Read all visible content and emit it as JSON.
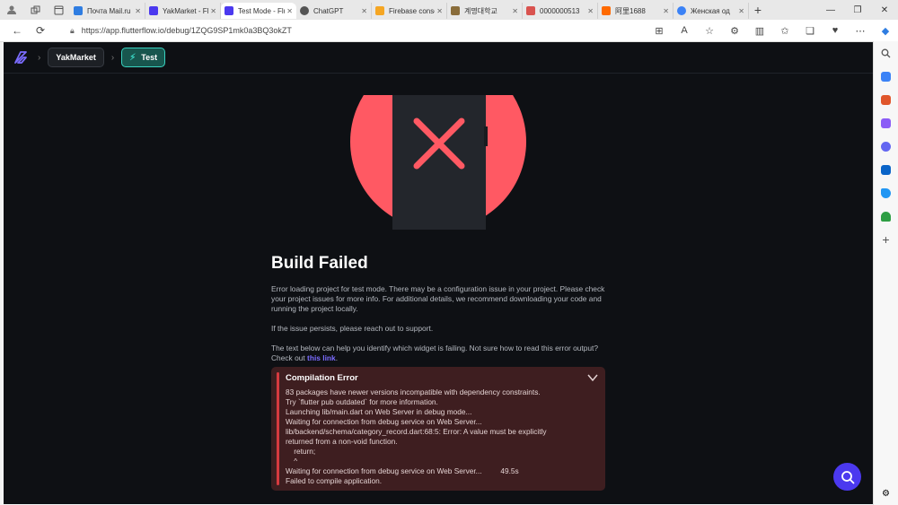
{
  "browser": {
    "tabs": [
      {
        "title": "Почта Mail.ru",
        "favicon_color": "#2f7de1",
        "active": false
      },
      {
        "title": "YakMarket - FlutterFlow",
        "favicon_color": "#4b39ef",
        "active": false
      },
      {
        "title": "Test Mode - FlutterFlow",
        "favicon_color": "#4b39ef",
        "active": true
      },
      {
        "title": "ChatGPT",
        "favicon_color": "#555555",
        "active": false
      },
      {
        "title": "Firebase console",
        "favicon_color": "#f5a623",
        "active": false
      },
      {
        "title": "계명대학교",
        "favicon_color": "#8a6d3b",
        "active": false
      },
      {
        "title": "0000000513",
        "favicon_color": "#d9534f",
        "active": false
      },
      {
        "title": "阿里1688",
        "favicon_color": "#ff6a00",
        "active": false
      },
      {
        "title": "Женская од",
        "favicon_color": "#3b82f6",
        "active": false
      }
    ],
    "url": "https://app.flutterflow.io/debug/1ZQG9SP1mk0a3BQ3okZT"
  },
  "app": {
    "breadcrumb": {
      "project": "YakMarket",
      "mode": "Test"
    },
    "title": "Build Failed",
    "paragraph1": "Error loading project for test mode. There may be a configuration issue in your project. Please check your project issues for more info. For additional details, we recommend downloading your code and running the project locally.",
    "paragraph2": "If the issue persists, please reach out to support.",
    "paragraph3_prefix": "The text below can help you identify which widget is failing. Not sure how to read this error output? Check out ",
    "paragraph3_link": "this link",
    "paragraph3_suffix": ".",
    "error": {
      "title": "Compilation Error",
      "lines": [
        "83 packages have newer versions incompatible with dependency constraints.",
        "Try `flutter pub outdated` for more information.",
        "Launching lib/main.dart on Web Server in debug mode...",
        "Waiting for connection from debug service on Web Server...",
        "lib/backend/schema/category_record.dart:68:5: Error: A value must be explicitly",
        "returned from a non-void function.",
        "    return;",
        "    ^",
        "Waiting for connection from debug service on Web Server...         49.5s",
        "Failed to compile application."
      ]
    },
    "colors": {
      "accent": "#4b39ef",
      "teal": "#39d2c0",
      "error": "#ff5963",
      "background": "#0e1014"
    }
  }
}
